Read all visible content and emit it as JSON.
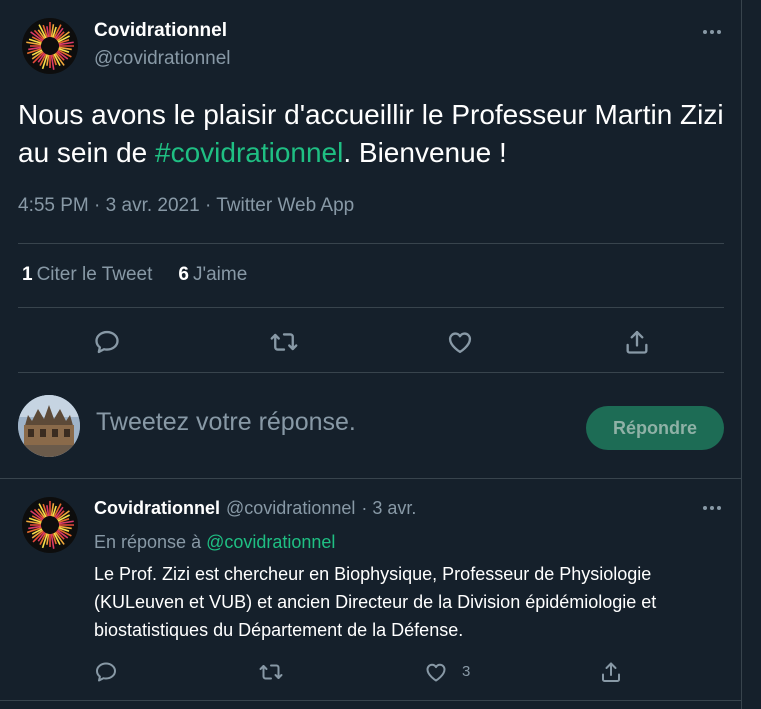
{
  "main_tweet": {
    "author_name": "Covidrationnel",
    "author_handle": "@covidrationnel",
    "text_part1": "Nous avons le plaisir d'accueillir le Professeur Martin Zizi au sein de ",
    "hashtag": "#covidrationnel",
    "text_part2": ". Bienvenue !",
    "time": "4:55 PM",
    "date": "3 avr. 2021",
    "source": "Twitter Web App",
    "sep": " · ",
    "quote_count": "1",
    "quote_label": "Citer le Tweet",
    "like_count": "6",
    "like_label": "J'aime"
  },
  "reply_box": {
    "placeholder": "Tweetez votre réponse.",
    "button_label": "Répondre"
  },
  "reply_tweet": {
    "author_name": "Covidrationnel",
    "author_handle": "@covidrationnel",
    "date": "· 3 avr.",
    "in_reply_prefix": "En réponse à",
    "in_reply_handle": "@covidrationnel",
    "text": "Le Prof. Zizi est chercheur en Biophysique, Professeur de Physiologie (KULeuven et VUB) et ancien Directeur de la Division épidémiologie et biostatistiques du Département de la Défense.",
    "like_count": "3"
  },
  "icons": [
    "more-icon",
    "reply-icon",
    "retweet-icon",
    "like-icon",
    "share-icon"
  ],
  "colors": {
    "background": "#15202b",
    "accent": "#1fbf83",
    "muted": "#8899a6",
    "border": "#38444d"
  }
}
